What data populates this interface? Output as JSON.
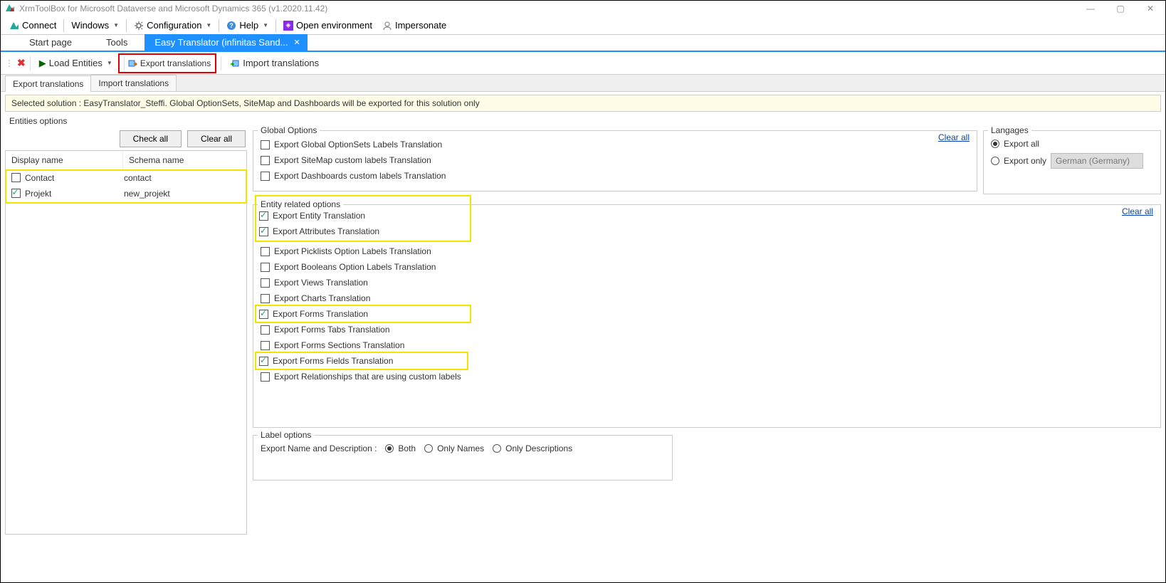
{
  "title": "XrmToolBox for Microsoft Dataverse and Microsoft Dynamics 365 (v1.2020.11.42)",
  "menubar": {
    "connect": "Connect",
    "windows": "Windows",
    "configuration": "Configuration",
    "help": "Help",
    "open_env": "Open environment",
    "impersonate": "Impersonate"
  },
  "tabs": {
    "start": "Start page",
    "tools": "Tools",
    "active": "Easy Translator (infinitas Sand...",
    "close_x": "✕"
  },
  "toolbar": {
    "load_entities": "Load Entities",
    "export_translations": "Export translations",
    "import_translations": "Import translations"
  },
  "subtabs": {
    "export": "Export translations",
    "import": "Import translations"
  },
  "banner": "Selected solution : EasyTranslator_Steffi. Global OptionSets, SiteMap and Dashboards will be exported for this solution only",
  "entities_options_label": "Entities options",
  "check_all": "Check all",
  "clear_all_btn": "Clear all",
  "entity_headers": {
    "display": "Display name",
    "schema": "Schema name"
  },
  "entities": [
    {
      "display": "Contact",
      "schema": "contact",
      "checked": false
    },
    {
      "display": "Projekt",
      "schema": "new_projekt",
      "checked": true
    }
  ],
  "global_options": {
    "legend": "Global Options",
    "items": [
      {
        "label": "Export Global OptionSets Labels Translation",
        "checked": false
      },
      {
        "label": "Export SiteMap custom labels Translation",
        "checked": false
      },
      {
        "label": "Export Dashboards custom labels Translation",
        "checked": false
      }
    ],
    "clear_all": "Clear all"
  },
  "entity_related": {
    "legend": "Entity related options",
    "clear_all": "Clear all",
    "items": [
      {
        "label": "Export Entity Translation",
        "checked": true
      },
      {
        "label": "Export Attributes Translation",
        "checked": true
      },
      {
        "label": "Export Picklists Option Labels Translation",
        "checked": false
      },
      {
        "label": "Export Booleans Option Labels Translation",
        "checked": false
      },
      {
        "label": "Export Views Translation",
        "checked": false
      },
      {
        "label": "Export Charts Translation",
        "checked": false
      },
      {
        "label": "Export Forms Translation",
        "checked": true
      },
      {
        "label": "Export Forms Tabs Translation",
        "checked": false
      },
      {
        "label": "Export Forms Sections Translation",
        "checked": false
      },
      {
        "label": "Export Forms Fields Translation",
        "checked": true
      },
      {
        "label": "Export Relationships that are using custom labels",
        "checked": false
      }
    ]
  },
  "label_options": {
    "legend": "Label options",
    "prompt": "Export Name and Description :",
    "radios": [
      {
        "label": "Both",
        "checked": true
      },
      {
        "label": "Only Names",
        "checked": false
      },
      {
        "label": "Only Descriptions",
        "checked": false
      }
    ]
  },
  "languages": {
    "legend": "Langages",
    "export_all": "Export all",
    "export_only": "Export only",
    "selected_lang": "German (Germany)"
  }
}
